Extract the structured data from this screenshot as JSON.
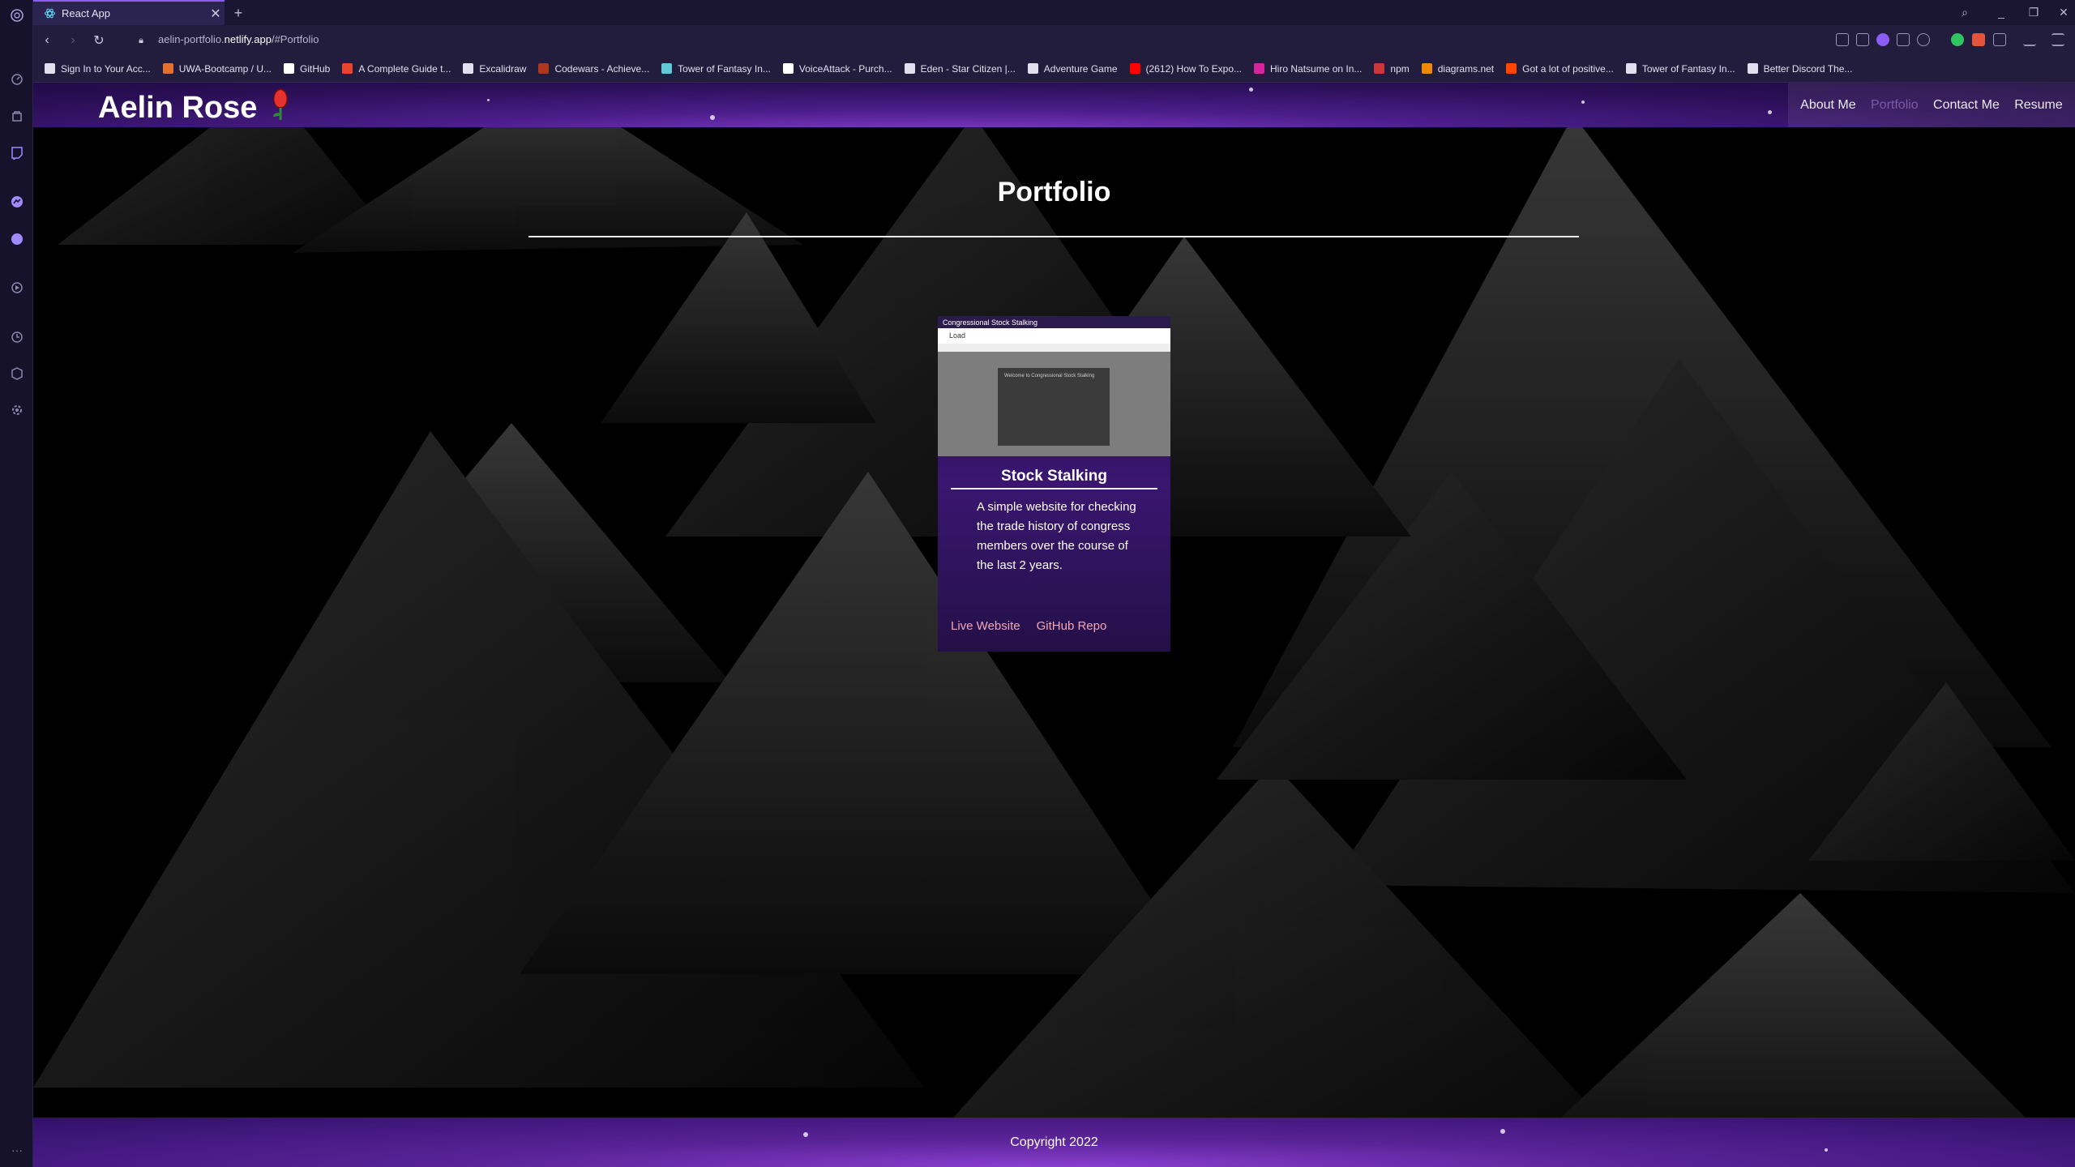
{
  "browser": {
    "tab_title": "React App",
    "tab_close": "✕",
    "new_tab": "+",
    "url_host_prefix": "aelin-portfolio.",
    "url_host": "netlify.app",
    "url_path": "/#Portfolio",
    "back": "‹",
    "forward": "›",
    "reload": "↻",
    "minimize": "_",
    "restore": "❐",
    "close": "✕"
  },
  "bookmarks": [
    {
      "label": "Sign In to Your Acc...",
      "color": "#e2dfee"
    },
    {
      "label": "UWA-Bootcamp / U...",
      "color": "#e66f2b"
    },
    {
      "label": "GitHub",
      "color": "#ffffff"
    },
    {
      "label": "A Complete Guide t...",
      "color": "#e8452c"
    },
    {
      "label": "Excalidraw",
      "color": "#e2dfee"
    },
    {
      "label": "Codewars - Achieve...",
      "color": "#b1361e"
    },
    {
      "label": "Tower of Fantasy In...",
      "color": "#5fc9d8"
    },
    {
      "label": "VoiceAttack - Purch...",
      "color": "#ffffff"
    },
    {
      "label": "Eden - Star Citizen |...",
      "color": "#e2dfee"
    },
    {
      "label": "Adventure Game",
      "color": "#e2dfee"
    },
    {
      "label": "(2612) How To Expo...",
      "color": "#ff0000"
    },
    {
      "label": "Hiro Natsume on In...",
      "color": "#d6249f"
    },
    {
      "label": "npm",
      "color": "#cb3837"
    },
    {
      "label": "diagrams.net",
      "color": "#f08705"
    },
    {
      "label": "Got a lot of positive...",
      "color": "#ff4500"
    },
    {
      "label": "Tower of Fantasy In...",
      "color": "#e2dfee"
    },
    {
      "label": "Better Discord The...",
      "color": "#e2dfee"
    }
  ],
  "site": {
    "name": "Aelin Rose",
    "nav": [
      "About Me",
      "Portfolio",
      "Contact Me",
      "Resume"
    ],
    "active_nav": "Portfolio",
    "page_title": "Portfolio",
    "footer": "Copyright 2022"
  },
  "project": {
    "title": "Stock Stalking",
    "description": "A simple website for checking the trade history of congress members over the course of the last 2 years.",
    "live_link": "Live Website",
    "repo_link": "GitHub Repo",
    "screenshot": {
      "app_title": "Congressional Stock Stalking",
      "search_text": "Load",
      "welcome": "Welcome to Congressional Stock Stalking"
    }
  },
  "colors": {
    "accent": "#8b5cf6",
    "link": "#f5a6b5",
    "active_nav": "#7d5aa8",
    "header": "#4b1d8a"
  }
}
